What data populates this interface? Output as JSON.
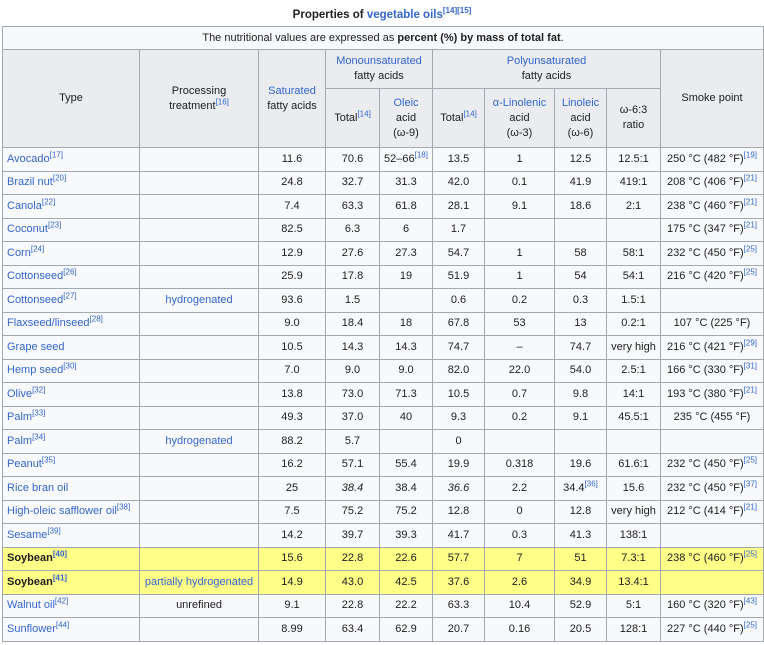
{
  "caption": {
    "prefix": "Properties of ",
    "link": "vegetable oils",
    "refs": "[14][15]"
  },
  "note": {
    "pre": "The nutritional values are expressed as ",
    "bold": "percent (%) by mass of total fat",
    "post": "."
  },
  "headers": {
    "type": "Type",
    "processing": "Processing treatment",
    "processing_ref": "[16]",
    "saturated": "Saturated",
    "saturated_sub": "fatty acids",
    "mono": "Monounsaturated",
    "mono_sub": "fatty acids",
    "poly": "Polyunsaturated",
    "poly_sub": "fatty acids",
    "smoke": "Smoke point",
    "mono_total": "Total",
    "mono_total_ref": "[14]",
    "oleic": "Oleic",
    "oleic_sub": "acid",
    "oleic_note": "(ω-9)",
    "poly_total": "Total",
    "poly_total_ref": "[14]",
    "alpha": "α-Linolenic",
    "alpha_sub": "acid",
    "alpha_note": "(ω-3)",
    "linoleic": "Linoleic",
    "linoleic_sub": "acid",
    "linoleic_note": "(ω-6)",
    "ratio": "ω-6:3",
    "ratio_sub": "ratio"
  },
  "rows": [
    {
      "type": "Avocado",
      "ref": "[17]",
      "proc": "",
      "sat": "11.6",
      "mt": "70.6",
      "ole": "52–66",
      "ole_ref": "[18]",
      "pt": "13.5",
      "ala": "1",
      "lin": "12.5",
      "ratio": "12.5:1",
      "smoke": "250 °C (482 °F)",
      "smoke_ref": "[19]"
    },
    {
      "type": "Brazil nut",
      "ref": "[20]",
      "proc": "",
      "sat": "24.8",
      "mt": "32.7",
      "ole": "31.3",
      "ole_ref": "",
      "pt": "42.0",
      "ala": "0.1",
      "lin": "41.9",
      "ratio": "419:1",
      "smoke": "208 °C (406 °F)",
      "smoke_ref": "[21]"
    },
    {
      "type": "Canola",
      "ref": "[22]",
      "proc": "",
      "sat": "7.4",
      "mt": "63.3",
      "ole": "61.8",
      "ole_ref": "",
      "pt": "28.1",
      "ala": "9.1",
      "lin": "18.6",
      "ratio": "2:1",
      "smoke": "238 °C (460 °F)",
      "smoke_ref": "[21]"
    },
    {
      "type": "Coconut",
      "ref": "[23]",
      "proc": "",
      "sat": "82.5",
      "mt": "6.3",
      "ole": "6",
      "ole_ref": "",
      "pt": "1.7",
      "ala": "",
      "lin": "",
      "ratio": "",
      "smoke": "175 °C (347 °F)",
      "smoke_ref": "[21]"
    },
    {
      "type": "Corn",
      "ref": "[24]",
      "proc": "",
      "sat": "12.9",
      "mt": "27.6",
      "ole": "27.3",
      "ole_ref": "",
      "pt": "54.7",
      "ala": "1",
      "lin": "58",
      "ratio": "58:1",
      "smoke": "232 °C (450 °F)",
      "smoke_ref": "[25]"
    },
    {
      "type": "Cottonseed",
      "ref": "[26]",
      "proc": "",
      "sat": "25.9",
      "mt": "17.8",
      "ole": "19",
      "ole_ref": "",
      "pt": "51.9",
      "ala": "1",
      "lin": "54",
      "ratio": "54:1",
      "smoke": "216 °C (420 °F)",
      "smoke_ref": "[25]"
    },
    {
      "type": "Cottonseed",
      "ref": "[27]",
      "proc": "hydrogenated",
      "sat": "93.6",
      "mt": "1.5",
      "ole": "",
      "ole_ref": "",
      "pt": "0.6",
      "ala": "0.2",
      "lin": "0.3",
      "ratio": "1.5:1",
      "smoke": "",
      "smoke_ref": ""
    },
    {
      "type": "Flaxseed/linseed",
      "ref": "[28]",
      "proc": "",
      "sat": "9.0",
      "mt": "18.4",
      "ole": "18",
      "ole_ref": "",
      "pt": "67.8",
      "ala": "53",
      "lin": "13",
      "ratio": "0.2:1",
      "smoke": "107 °C (225 °F)",
      "smoke_ref": ""
    },
    {
      "type": "Grape seed",
      "ref": "",
      "proc": "",
      "sat": "10.5",
      "mt": "14.3",
      "ole": "14.3",
      "ole_ref": "",
      "pt": "74.7",
      "ala": "–",
      "lin": "74.7",
      "ratio": "very high",
      "smoke": "216 °C (421 °F)",
      "smoke_ref": "[29]"
    },
    {
      "type": "Hemp seed",
      "ref": "[30]",
      "proc": "",
      "sat": "7.0",
      "mt": "9.0",
      "ole": "9.0",
      "ole_ref": "",
      "pt": "82.0",
      "ala": "22.0",
      "lin": "54.0",
      "ratio": "2.5:1",
      "smoke": "166 °C (330 °F)",
      "smoke_ref": "[31]"
    },
    {
      "type": "Olive",
      "ref": "[32]",
      "proc": "",
      "sat": "13.8",
      "mt": "73.0",
      "ole": "71.3",
      "ole_ref": "",
      "pt": "10.5",
      "ala": "0.7",
      "lin": "9.8",
      "ratio": "14:1",
      "smoke": "193 °C (380 °F)",
      "smoke_ref": "[21]"
    },
    {
      "type": "Palm",
      "ref": "[33]",
      "proc": "",
      "sat": "49.3",
      "mt": "37.0",
      "ole": "40",
      "ole_ref": "",
      "pt": "9.3",
      "ala": "0.2",
      "lin": "9.1",
      "ratio": "45.5:1",
      "smoke": "235 °C (455 °F)",
      "smoke_ref": ""
    },
    {
      "type": "Palm",
      "ref": "[34]",
      "proc": "hydrogenated",
      "sat": "88.2",
      "mt": "5.7",
      "ole": "",
      "ole_ref": "",
      "pt": "0",
      "ala": "",
      "lin": "",
      "ratio": "",
      "smoke": "",
      "smoke_ref": ""
    },
    {
      "type": "Peanut",
      "ref": "[35]",
      "proc": "",
      "sat": "16.2",
      "mt": "57.1",
      "ole": "55.4",
      "ole_ref": "",
      "pt": "19.9",
      "ala": "0.318",
      "lin": "19.6",
      "ratio": "61.6:1",
      "smoke": "232 °C (450 °F)",
      "smoke_ref": "[25]"
    },
    {
      "type": "Rice bran oil",
      "ref": "",
      "proc": "",
      "sat": "25",
      "mt": "38.4",
      "mt_ital": true,
      "ole": "38.4",
      "ole_ref": "",
      "pt": "36.6",
      "pt_ital": true,
      "ala": "2.2",
      "lin": "34.4",
      "lin_ref": "[36]",
      "ratio": "15.6",
      "smoke": "232 °C (450 °F)",
      "smoke_ref": "[37]"
    },
    {
      "type": "High-oleic safflower oil",
      "ref": "[38]",
      "proc": "",
      "sat": "7.5",
      "mt": "75.2",
      "ole": "75.2",
      "ole_ref": "",
      "pt": "12.8",
      "ala": "0",
      "lin": "12.8",
      "ratio": "very high",
      "smoke": "212 °C (414 °F)",
      "smoke_ref": "[21]"
    },
    {
      "type": "Sesame",
      "ref": "[39]",
      "proc": "",
      "sat": "14.2",
      "mt": "39.7",
      "ole": "39.3",
      "ole_ref": "",
      "pt": "41.7",
      "ala": "0.3",
      "lin": "41.3",
      "ratio": "138:1",
      "smoke": "",
      "smoke_ref": ""
    },
    {
      "type": "Soybean",
      "ref": "[40]",
      "proc": "",
      "sat": "15.6",
      "mt": "22.8",
      "ole": "22.6",
      "ole_ref": "",
      "pt": "57.7",
      "ala": "7",
      "lin": "51",
      "ratio": "7.3:1",
      "smoke": "238 °C (460 °F)",
      "smoke_ref": "[25]",
      "hl": true
    },
    {
      "type": "Soybean",
      "ref": "[41]",
      "proc": "partially hydrogenated",
      "sat": "14.9",
      "mt": "43.0",
      "ole": "42.5",
      "ole_ref": "",
      "pt": "37.6",
      "ala": "2.6",
      "lin": "34.9",
      "ratio": "13.4:1",
      "smoke": "",
      "smoke_ref": "",
      "hl": true
    },
    {
      "type": "Walnut oil",
      "ref": "[42]",
      "proc": "unrefined",
      "proc_plain": true,
      "sat": "9.1",
      "mt": "22.8",
      "ole": "22.2",
      "ole_ref": "",
      "pt": "63.3",
      "ala": "10.4",
      "lin": "52.9",
      "ratio": "5:1",
      "smoke": "160 °C (320 °F)",
      "smoke_ref": "[43]"
    },
    {
      "type": "Sunflower",
      "ref": "[44]",
      "proc": "",
      "sat": "8.99",
      "mt": "63.4",
      "ole": "62.9",
      "ole_ref": "",
      "pt": "20.7",
      "ala": "0.16",
      "lin": "20.5",
      "ratio": "128:1",
      "smoke": "227 °C (440 °F)",
      "smoke_ref": "[25]"
    }
  ]
}
